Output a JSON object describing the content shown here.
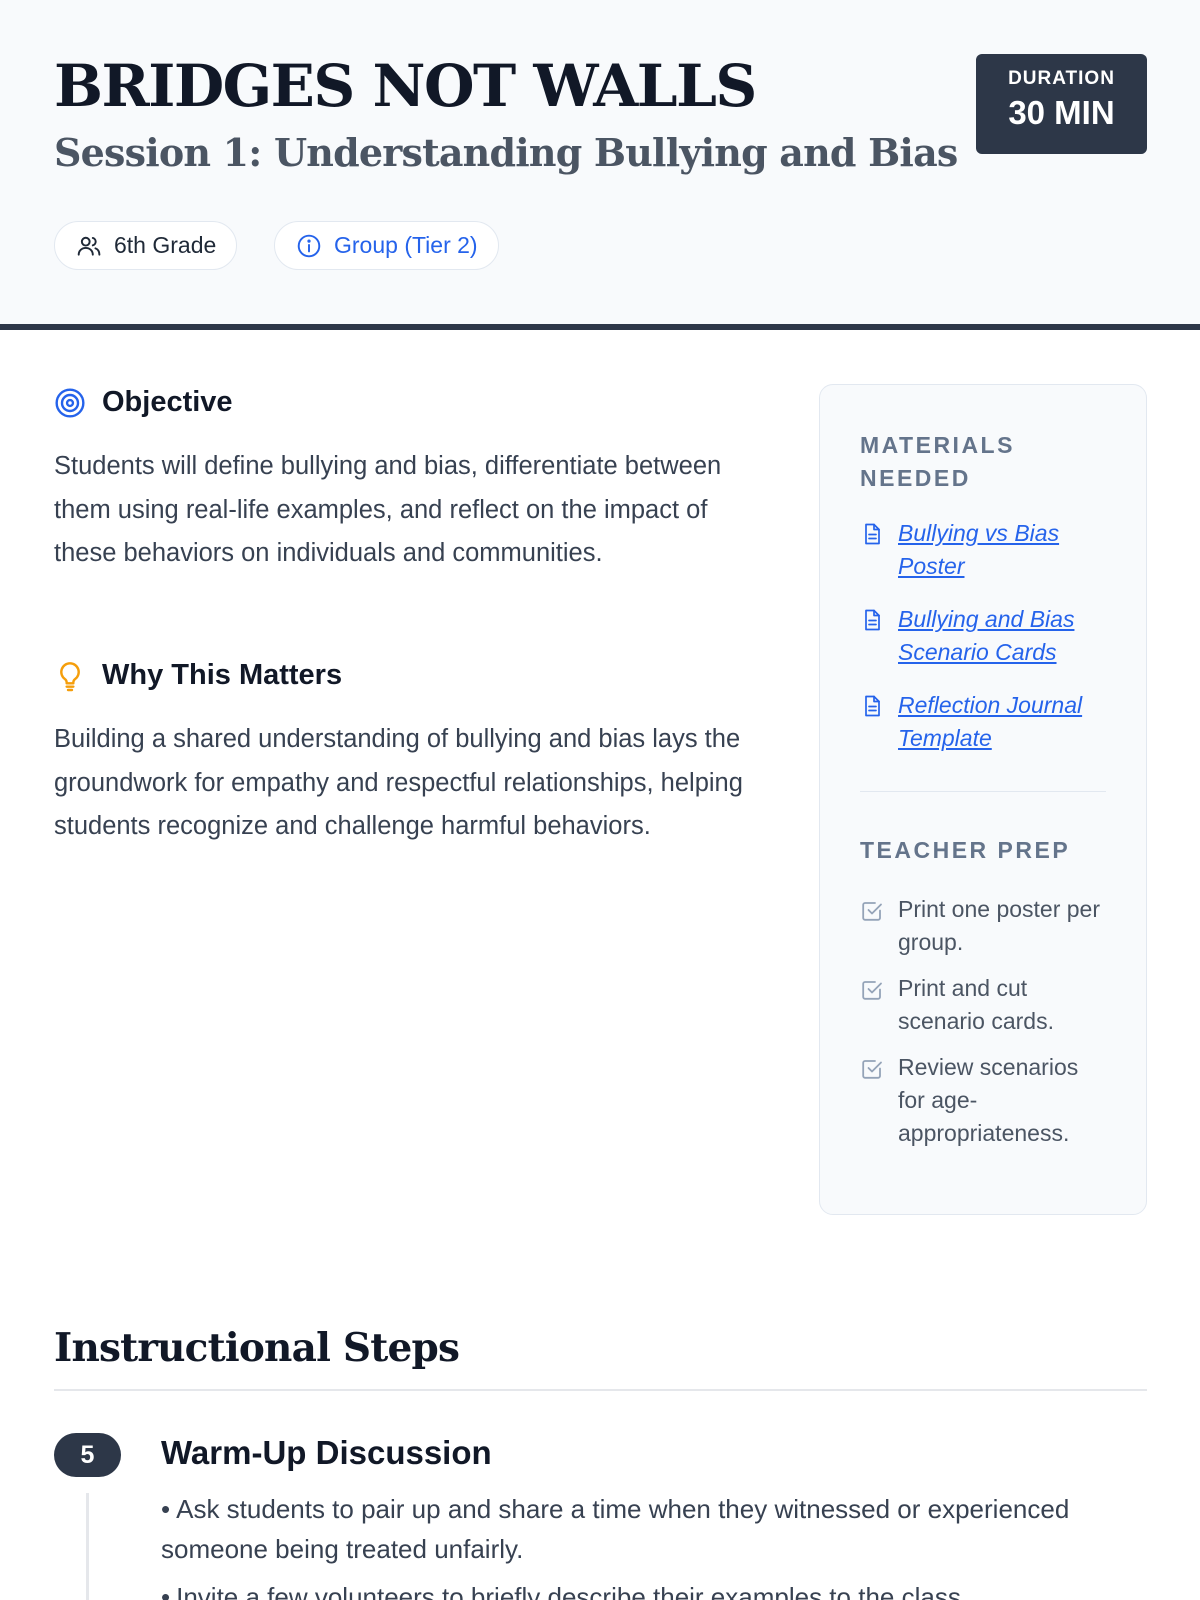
{
  "header": {
    "title": "BRIDGES NOT WALLS",
    "subtitle": "Session 1: Understanding Bullying and Bias",
    "duration_label": "DURATION",
    "duration_value": "30 MIN",
    "tags": [
      {
        "label": "6th Grade",
        "icon": "users-icon"
      },
      {
        "label": "Group (Tier 2)",
        "icon": "info-icon"
      }
    ]
  },
  "objective": {
    "heading": "Objective",
    "icon": "target-icon",
    "text": "Students will define bullying and bias, differentiate between them using real-life examples, and reflect on the impact of these behaviors on individuals and communities."
  },
  "why": {
    "heading": "Why This Matters",
    "icon": "lightbulb-icon",
    "text": "Building a shared understanding of bullying and bias lays the groundwork for empathy and respectful relationships, helping students recognize and challenge harmful behaviors."
  },
  "materials": {
    "heading": "MATERIALS NEEDED",
    "items": [
      {
        "label": "Bullying vs Bias Poster",
        "icon": "document-icon"
      },
      {
        "label": "Bullying and Bias Scenario Cards",
        "icon": "document-icon"
      },
      {
        "label": "Reflection Journal Template",
        "icon": "document-icon"
      }
    ]
  },
  "prep": {
    "heading": "TEACHER PREP",
    "items": [
      {
        "label": "Print one poster per group.",
        "icon": "checkbox-icon"
      },
      {
        "label": "Print and cut scenario cards.",
        "icon": "checkbox-icon"
      },
      {
        "label": "Review scenarios for age-appropriateness.",
        "icon": "checkbox-icon"
      }
    ]
  },
  "steps": {
    "heading": "Instructional Steps",
    "items": [
      {
        "number": "5",
        "title": "Warm-Up Discussion",
        "bullets": [
          "Ask students to pair up and share a time when they witnessed or experienced someone being treated unfairly.",
          "Invite a few volunteers to briefly describe their examples to the class."
        ]
      }
    ]
  },
  "colors": {
    "accent": "#2563eb",
    "dark": "#2d3748",
    "warning": "#f59e0b",
    "muted": "#64748b"
  }
}
